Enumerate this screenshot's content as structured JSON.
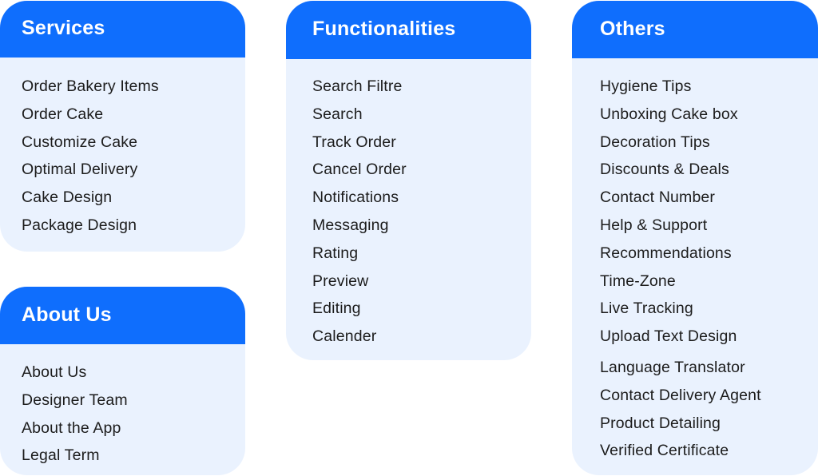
{
  "colors": {
    "header_bg": "#0f6efd",
    "card_bg": "#eaf2fe",
    "header_text": "#ffffff",
    "item_text": "#1c1c1c"
  },
  "services": {
    "title": "Services",
    "items": [
      "Order Bakery Items",
      "Order Cake",
      "Customize Cake",
      "Optimal Delivery",
      "Cake Design",
      "Package Design"
    ]
  },
  "about": {
    "title": "About Us",
    "items": [
      "About Us",
      "Designer Team",
      "About the App",
      "Legal Term"
    ]
  },
  "functionalities": {
    "title": "Functionalities",
    "items": [
      "Search Filtre",
      "Search",
      "Track Order",
      "Cancel Order",
      "Notifications",
      "Messaging",
      "Rating",
      "Preview",
      "Editing",
      "Calender"
    ]
  },
  "others": {
    "title": "Others",
    "items": [
      "Hygiene Tips",
      "Unboxing Cake box",
      "Decoration Tips",
      "Discounts & Deals",
      "Contact Number",
      "Help & Support",
      "Recommendations",
      "Time-Zone",
      "Live Tracking",
      "Upload Text Design",
      "Language Translator",
      "Contact Delivery Agent",
      "Product Detailing",
      "Verified Certificate"
    ]
  }
}
